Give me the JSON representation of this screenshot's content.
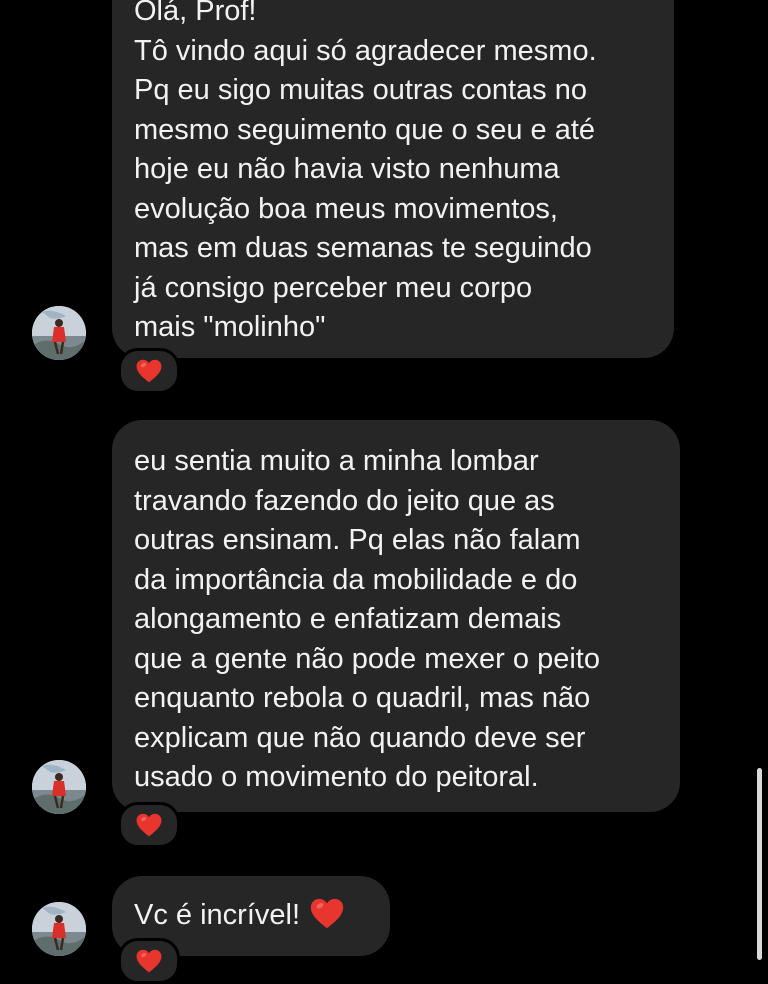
{
  "messages": [
    {
      "lines": [
        "Olá, Prof!",
        "Tô vindo aqui só agradecer mesmo.",
        "Pq eu sigo muitas outras contas no",
        "mesmo seguimento que o seu e até",
        "hoje eu não havia visto nenhuma",
        "evolução boa meus movimentos,",
        "mas em duas semanas te seguindo",
        "já consigo perceber meu corpo",
        "mais \"molinho\""
      ],
      "reaction": "heart"
    },
    {
      "lines": [
        "eu sentia muito a minha lombar",
        "travando fazendo do jeito que as",
        "outras ensinam. Pq elas não falam",
        "da importância da mobilidade e do",
        "alongamento e enfatizam demais",
        "que a gente não pode mexer o peito",
        "enquanto rebola o quadril, mas não",
        "explicam que não quando deve ser",
        "usado o movimento do peitoral."
      ],
      "reaction": "heart"
    },
    {
      "lines": [
        "Vc é incrível!"
      ],
      "emoji": "heart",
      "reaction": "heart"
    }
  ],
  "colors": {
    "background": "#000000",
    "bubble": "#262626",
    "text": "#f2f2f2",
    "heart": "#e8352e"
  },
  "icons": {
    "avatar": "sender-avatar-icon",
    "reaction": "heart-reaction-icon"
  }
}
